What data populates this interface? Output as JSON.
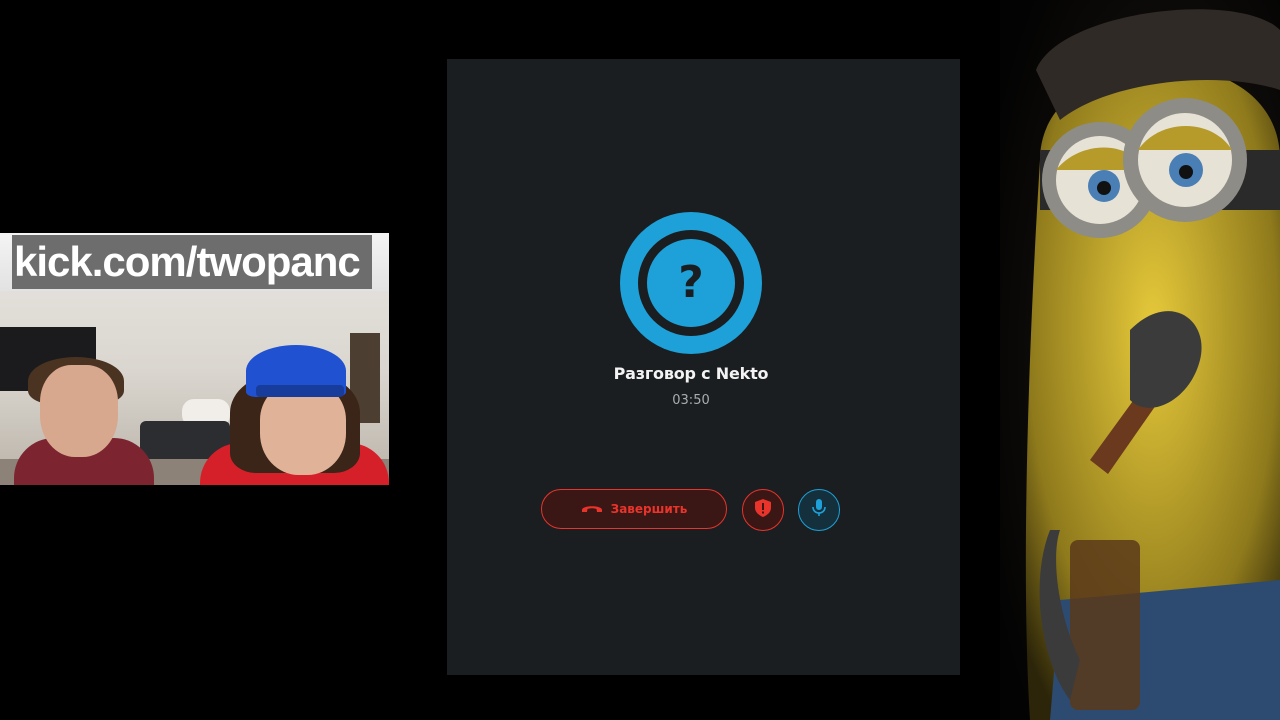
{
  "webcam": {
    "banner_text": "kick.com/twopanc"
  },
  "call": {
    "avatar_glyph": "?",
    "title": "Разговор с Nekto",
    "timer": "03:50",
    "end_button_label": "Завершить",
    "end_button_icon": "phone-hangup-icon",
    "report_icon": "shield-alert-icon",
    "mic_icon": "microphone-icon"
  },
  "colors": {
    "accent_blue": "#1da1d8",
    "danger_red": "#e8342b",
    "panel_bg": "#1b1e21",
    "page_bg": "#000000"
  }
}
